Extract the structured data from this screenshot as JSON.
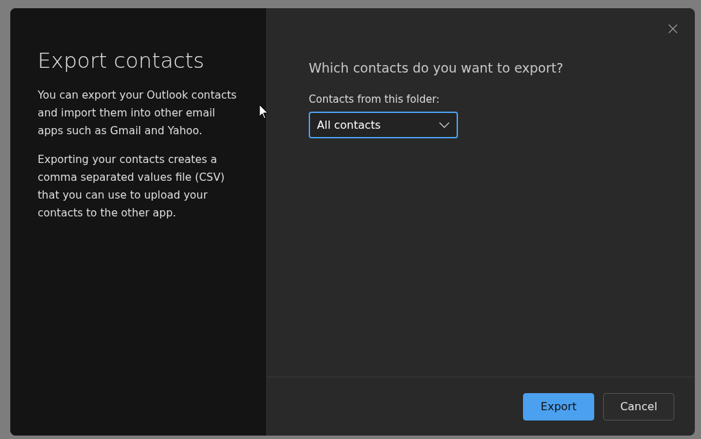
{
  "dialog": {
    "title": "Export contacts",
    "paragraphs": [
      "You can export your Outlook contacts and import them into other email apps such as Gmail and Yahoo.",
      "Exporting your contacts creates a comma separated values file (CSV) that you can use to upload your contacts to the other app."
    ],
    "question": "Which contacts do you want to export?",
    "folder_label": "Contacts from this folder:",
    "folder_dropdown": {
      "value": "All contacts",
      "focused": true
    },
    "buttons": [
      {
        "label": "Export",
        "kind": "primary"
      },
      {
        "label": "Cancel",
        "kind": "secondary"
      }
    ]
  }
}
